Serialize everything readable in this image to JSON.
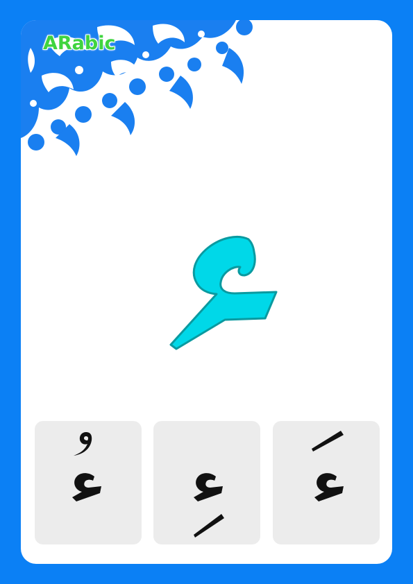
{
  "brand": {
    "label": "ARabic"
  },
  "colors": {
    "frame": "#0b80f5",
    "card": "#ffffff",
    "ornament": "#1a7ff0",
    "brand_text": "#3fd43f",
    "main_letter_fill": "#00d8e8",
    "main_letter_stroke": "#0a9aa0",
    "tile_bg": "#ececec",
    "tile_letter": "#111111"
  },
  "letter": {
    "name": "ain-isolated-shape"
  },
  "tiles": [
    {
      "diacritic": "damma"
    },
    {
      "diacritic": "kasra"
    },
    {
      "diacritic": "fatha"
    }
  ]
}
